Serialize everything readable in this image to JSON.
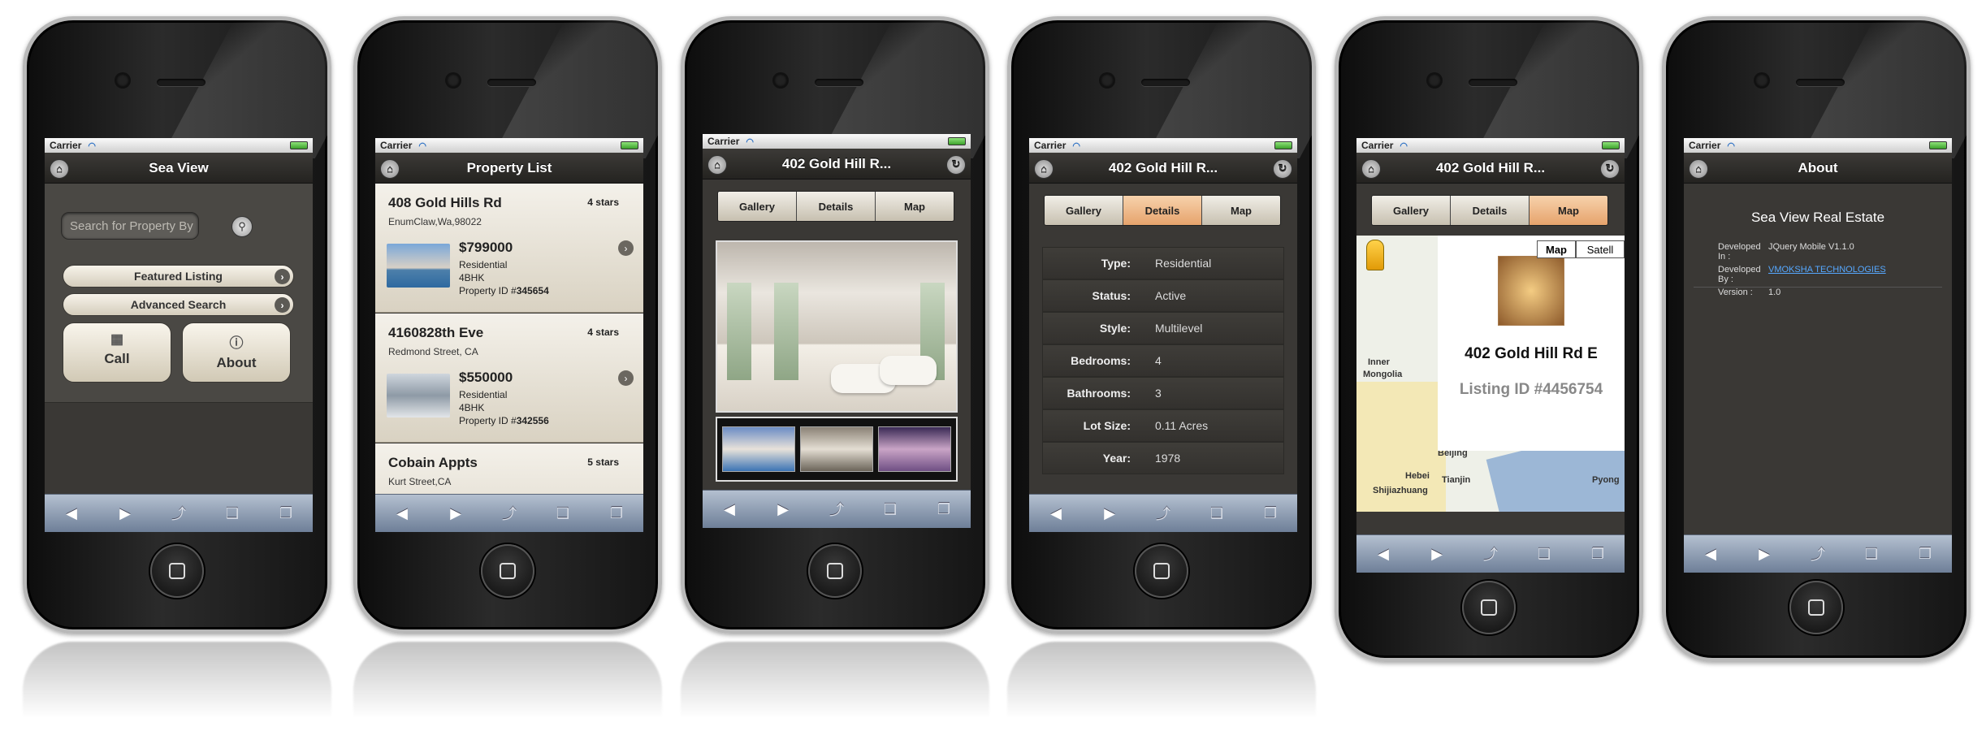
{
  "common": {
    "carrier": "Carrier",
    "tabbar_icons": [
      "back-arrow-icon",
      "forward-arrow-icon",
      "share-icon",
      "bookmarks-icon",
      "tabs-icon"
    ],
    "tabbar_glyphs": [
      "◀",
      "▶",
      "⤴",
      "📖",
      "❐"
    ]
  },
  "screen1": {
    "title": "Sea View",
    "search_placeholder": "Search for Property By",
    "featured_label": "Featured Listing",
    "advanced_label": "Advanced Search",
    "call_label": "Call",
    "about_label": "About"
  },
  "screen2": {
    "title": "Property List",
    "listings": [
      {
        "name": "408 Gold Hills Rd",
        "address": "EnumClaw,Wa,98022",
        "stars": "4 stars",
        "price": "$799000",
        "type": "Residential",
        "size": "4BHK",
        "id_label": "Property ID #",
        "id": "345654"
      },
      {
        "name": "4160828th Eve",
        "address": "Redmond Street, CA",
        "stars": "4 stars",
        "price": "$550000",
        "type": "Residential",
        "size": "4BHK",
        "id_label": "Property ID #",
        "id": "342556"
      },
      {
        "name": "Cobain Appts",
        "address": "Kurt Street,CA",
        "stars": "5 stars"
      }
    ]
  },
  "screen3": {
    "title": "402 Gold Hill R...",
    "tabs": [
      "Gallery",
      "Details",
      "Map"
    ]
  },
  "screen4": {
    "title": "402 Gold Hill R...",
    "tabs": [
      "Gallery",
      "Details",
      "Map"
    ],
    "details": [
      {
        "key": "Type:",
        "value": "Residential"
      },
      {
        "key": "Status:",
        "value": "Active"
      },
      {
        "key": "Style:",
        "value": "Multilevel"
      },
      {
        "key": "Bedrooms:",
        "value": "4"
      },
      {
        "key": "Bathrooms:",
        "value": "3"
      },
      {
        "key": "Lot Size:",
        "value": "0.11 Acres"
      },
      {
        "key": "Year:",
        "value": "1978"
      }
    ]
  },
  "screen5": {
    "title": "402 Gold Hill R...",
    "tabs": [
      "Gallery",
      "Details",
      "Map"
    ],
    "map_tab": "Map",
    "satellite_tab": "Satell",
    "place_title": "402 Gold Hill Rd E",
    "listing_id": "Listing ID #4456754",
    "labels": [
      "Inner",
      "Mongolia",
      "Beijing",
      "Tianjin",
      "Hebei",
      "Shijiazhuang",
      "Pyong"
    ]
  },
  "screen6": {
    "title": "About",
    "company": "Sea View Real Estate",
    "rows": [
      {
        "key": "Developed In :",
        "value": "JQuery Mobile V1.1.0"
      },
      {
        "key": "Developed By :",
        "value": "VMOKSHA TECHNOLOGIES"
      },
      {
        "key": "Version :",
        "value": "1.0"
      }
    ]
  }
}
